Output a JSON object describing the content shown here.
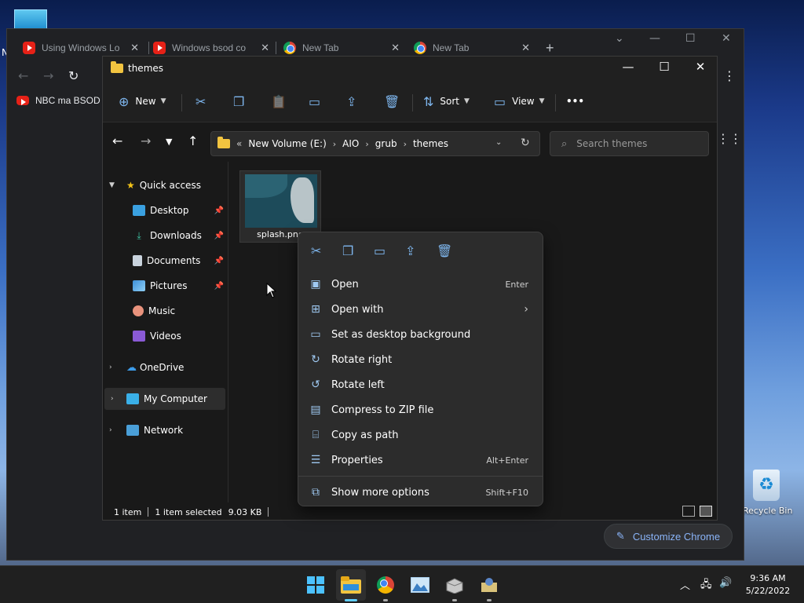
{
  "desktop": {
    "letter": "N",
    "recycle_bin_label": "Recycle Bin"
  },
  "chrome": {
    "tabs": [
      {
        "label": "Using Windows Lo",
        "icon": "youtube-icon"
      },
      {
        "label": "Windows bsod co",
        "icon": "youtube-icon"
      },
      {
        "label": "New Tab",
        "icon": "chrome-icon"
      },
      {
        "label": "New Tab",
        "icon": "chrome-icon"
      }
    ],
    "new_tab": "+",
    "bookmark": "NBC ma BSOD -",
    "customize_label": "Customize Chrome"
  },
  "explorer": {
    "title": "themes",
    "toolbar": {
      "new_label": "New",
      "sort_label": "Sort",
      "view_label": "View",
      "more_label": "•••"
    },
    "address": {
      "overflow": "«",
      "crumbs": [
        "New Volume (E:)",
        "AIO",
        "grub",
        "themes"
      ]
    },
    "search_placeholder": "Search themes",
    "nav": {
      "quick_access": "Quick access",
      "items": [
        "Desktop",
        "Downloads",
        "Documents",
        "Pictures",
        "Music",
        "Videos"
      ],
      "onedrive": "OneDrive",
      "my_computer": "My Computer",
      "network": "Network"
    },
    "file": {
      "name": "splash.png"
    },
    "status": {
      "count": "1 item",
      "selected": "1 item selected",
      "size": "9.03 KB"
    }
  },
  "context_menu": {
    "items": [
      {
        "label": "Open",
        "shortcut": "Enter"
      },
      {
        "label": "Open with",
        "shortcut": "›"
      },
      {
        "label": "Set as desktop background",
        "shortcut": ""
      },
      {
        "label": "Rotate right",
        "shortcut": ""
      },
      {
        "label": "Rotate left",
        "shortcut": ""
      },
      {
        "label": "Compress to ZIP file",
        "shortcut": ""
      },
      {
        "label": "Copy as path",
        "shortcut": ""
      },
      {
        "label": "Properties",
        "shortcut": "Alt+Enter"
      }
    ],
    "more": {
      "label": "Show more options",
      "shortcut": "Shift+F10"
    }
  },
  "taskbar": {
    "time": "9:36 AM",
    "date": "5/22/2022"
  },
  "colors": {
    "accent": "#60cdff",
    "icon_blue": "#7eb6ee",
    "folder": "#f2c440"
  }
}
